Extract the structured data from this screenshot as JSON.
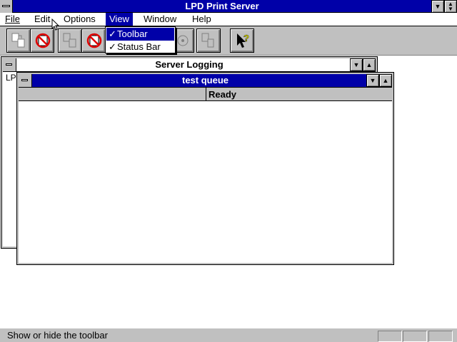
{
  "app": {
    "title": "LPD Print Server"
  },
  "menu": [
    "File",
    "Edit",
    "Options",
    "View",
    "Window",
    "Help"
  ],
  "view_menu": {
    "items": [
      {
        "check": "✓",
        "label": "Toolbar"
      },
      {
        "check": "✓",
        "label": "Status Bar"
      }
    ]
  },
  "windows": {
    "server_logging": {
      "title": "Server Logging",
      "text": "LP"
    },
    "test_queue": {
      "title": "test queue",
      "status": "Ready"
    }
  },
  "statusbar": {
    "text": "Show or hide the toolbar"
  },
  "colors": {
    "title_active": "#0000a8",
    "face": "#c0c0c0",
    "shadow": "#808080"
  },
  "icons": [
    "add-printer-icon",
    "remove-printer-icon",
    "copy-queue-icon",
    "disabled-queue-icon",
    "disk-icon",
    "document-icon",
    "context-help-icon"
  ]
}
